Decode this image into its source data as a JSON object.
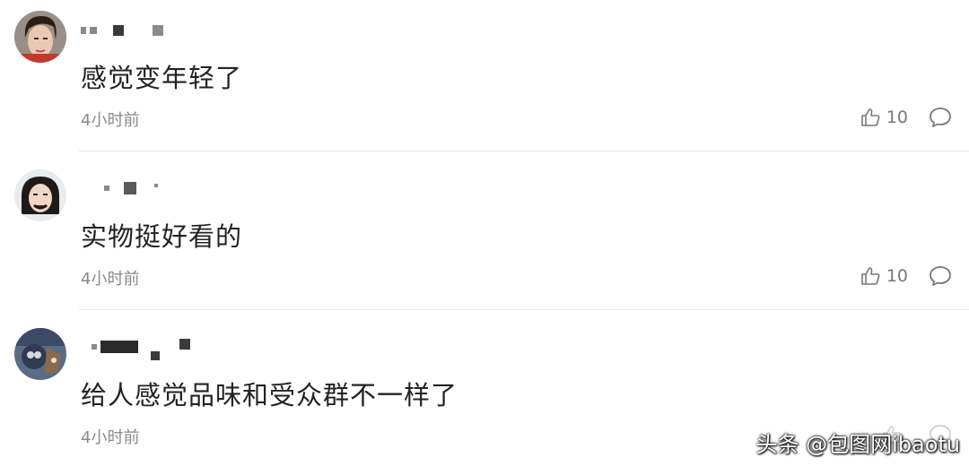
{
  "comments": [
    {
      "text": "感觉变年轻了",
      "time": "4小时前",
      "likes": "10"
    },
    {
      "text": "实物挺好看的",
      "time": "4小时前",
      "likes": "10"
    },
    {
      "text": "给人感觉品味和受众群不一样了",
      "time": "4小时前",
      "likes": ""
    }
  ],
  "icons": {
    "like": "thumbs-up-icon",
    "reply": "comment-bubble-icon"
  },
  "watermark": "头条 @包图网ibaotu"
}
